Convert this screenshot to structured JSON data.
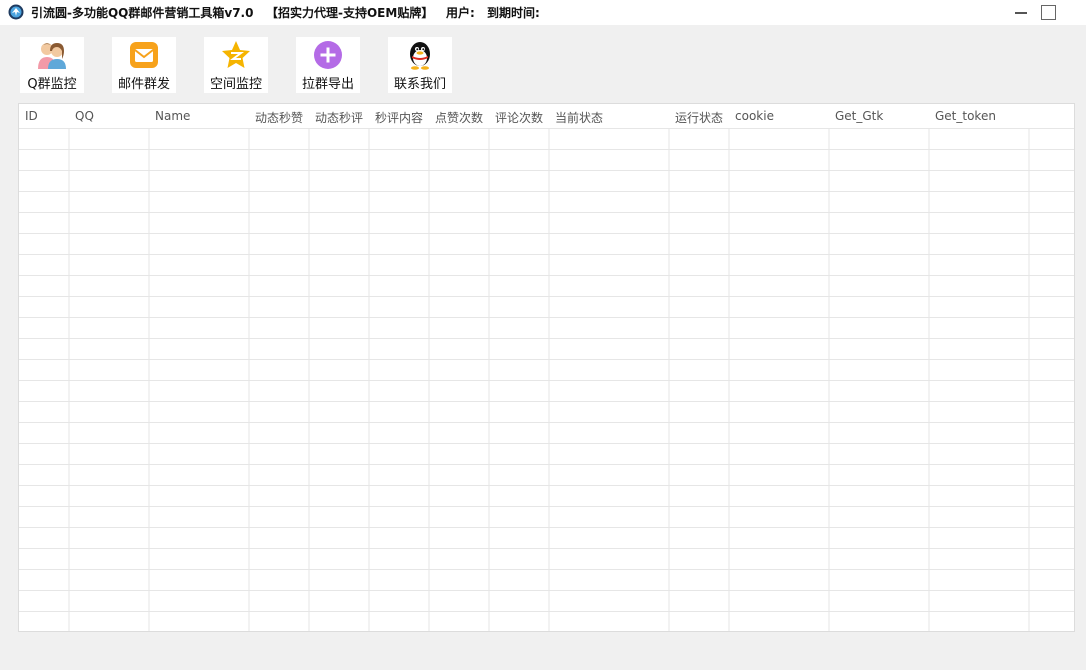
{
  "window": {
    "title_main": "引流圆-多功能QQ群邮件营销工具箱v7.0",
    "title_oem": "【招实力代理-支持OEM贴牌】",
    "user_label": "用户:",
    "expire_label": "到期时间:",
    "minimize_icon": "minimize-icon",
    "maximize_icon": "maximize-icon"
  },
  "toolbar": {
    "items": [
      {
        "label": "Q群监控",
        "icon": "users-icon"
      },
      {
        "label": "邮件群发",
        "icon": "mail-icon"
      },
      {
        "label": "空间监控",
        "icon": "qzone-star-icon"
      },
      {
        "label": "拉群导出",
        "icon": "plus-circle-icon"
      },
      {
        "label": "联系我们",
        "icon": "qq-penguin-icon"
      }
    ]
  },
  "grid": {
    "columns": [
      "ID",
      "QQ",
      "Name",
      "动态秒赞",
      "动态秒评",
      "秒评内容",
      "点赞次数",
      "评论次数",
      "当前状态",
      "运行状态",
      "cookie",
      "Get_Gtk",
      "Get_token"
    ],
    "rows": []
  },
  "colors": {
    "window_bg": "#f0f0f0",
    "grid_line": "#e6e6e6",
    "qzone_star": "#f5b400",
    "mail": "#f7a21b",
    "plus_circle": "#b46be6"
  }
}
